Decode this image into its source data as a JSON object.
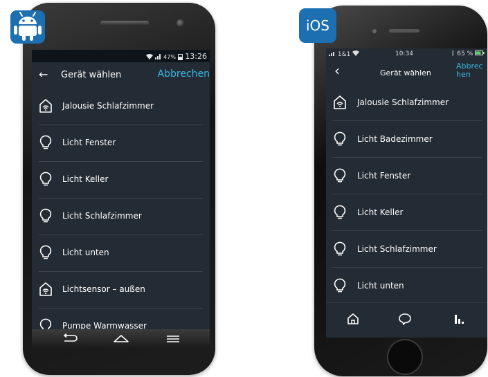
{
  "android": {
    "badge_icon": "android-icon",
    "status": {
      "battery": "47%",
      "time": "13:26"
    },
    "header": {
      "title": "Gerät wählen",
      "cancel": "Abbrechen",
      "back_icon": "arrow-left-icon"
    },
    "devices": [
      {
        "label": "Jalousie Schlafzimmer",
        "icon": "smart-home-icon"
      },
      {
        "label": "Licht Fenster",
        "icon": "bulb-icon"
      },
      {
        "label": "Licht Keller",
        "icon": "bulb-icon"
      },
      {
        "label": "Licht Schlafzimmer",
        "icon": "bulb-icon"
      },
      {
        "label": "Licht unten",
        "icon": "bulb-icon"
      },
      {
        "label": "Lichtsensor – außen",
        "icon": "smart-home-icon"
      },
      {
        "label": "Pumpe Warmwasser",
        "icon": "bulb-icon"
      }
    ],
    "navbar": [
      "back-nav-icon",
      "home-nav-icon",
      "menu-nav-icon"
    ]
  },
  "ios": {
    "badge": "iOS",
    "status": {
      "carrier": "1&1",
      "time": "10:34",
      "battery": "65 %"
    },
    "header": {
      "title": "Gerät wählen",
      "cancel": "Abbrechen",
      "back_icon": "chevron-left-icon"
    },
    "devices": [
      {
        "label": "Jalousie Schlafzimmer",
        "icon": "smart-home-icon"
      },
      {
        "label": "Licht Badezimmer",
        "icon": "bulb-icon"
      },
      {
        "label": "Licht Fenster",
        "icon": "bulb-icon"
      },
      {
        "label": "Licht Keller",
        "icon": "bulb-icon"
      },
      {
        "label": "Licht Schlafzimmer",
        "icon": "bulb-icon"
      },
      {
        "label": "Licht unten",
        "icon": "bulb-icon"
      }
    ],
    "tabs": [
      "home-icon",
      "chat-icon",
      "devices-icon"
    ]
  },
  "colors": {
    "screen_bg": "#232b34",
    "accent": "#3bb9e6",
    "badge_bg": "#1c6fb0",
    "divider": "#3a4450"
  }
}
